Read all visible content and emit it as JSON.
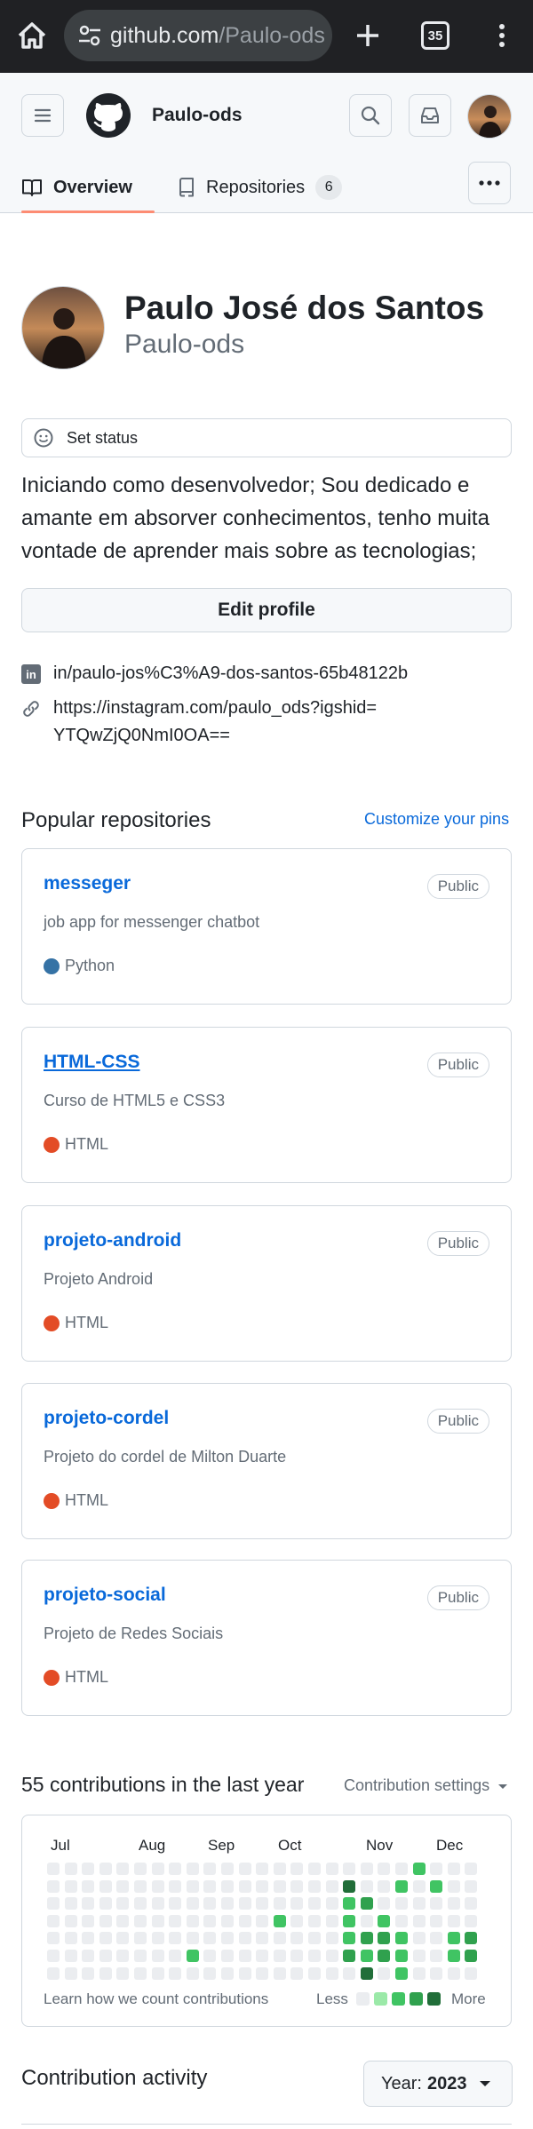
{
  "browser": {
    "url_host": "github.com",
    "url_path": "/Paulo-ods",
    "tab_count": "35"
  },
  "header": {
    "username": "Paulo-ods"
  },
  "tabs": {
    "overview": "Overview",
    "repositories": "Repositories",
    "repositories_count": "6"
  },
  "profile": {
    "full_name": "Paulo José dos Santos",
    "login": "Paulo-ods",
    "status_label": "Set status",
    "bio": "Iniciando como desenvolvedor; Sou dedicado e amante em absorver conhecimentos, tenho muita vontade de aprender mais sobre as tecnologias;",
    "edit_label": "Edit profile",
    "linkedin": "in/paulo-jos%C3%A9-dos-santos-65b48122b",
    "instagram": "https://instagram.com/paulo_ods?igshid=YTQwZjQ0NmI0OA=="
  },
  "popular": {
    "title": "Popular repositories",
    "customize_label": "Customize your pins",
    "repos": [
      {
        "name": "messeger",
        "visibility": "Public",
        "description": "job app for messenger chatbot",
        "language": "Python",
        "language_color": "#3572A5"
      },
      {
        "name": "HTML-CSS",
        "visibility": "Public",
        "description": "Curso de HTML5 e CSS3",
        "language": "HTML",
        "language_color": "#e34c26"
      },
      {
        "name": "projeto-android",
        "visibility": "Public",
        "description": "Projeto Android",
        "language": "HTML",
        "language_color": "#e34c26"
      },
      {
        "name": "projeto-cordel",
        "visibility": "Public",
        "description": "Projeto do cordel de Milton Duarte",
        "language": "HTML",
        "language_color": "#e34c26"
      },
      {
        "name": "projeto-social",
        "visibility": "Public",
        "description": "Projeto de Redes Sociais",
        "language": "HTML",
        "language_color": "#e34c26"
      }
    ]
  },
  "contributions": {
    "title": "55 contributions in the last year",
    "settings_label": "Contribution settings",
    "months": [
      "Jul",
      "Aug",
      "Sep",
      "Oct",
      "Nov",
      "Dec"
    ],
    "learn_label": "Learn how we count contributions",
    "less_label": "Less",
    "more_label": "More",
    "level_colors": [
      "#ebedf0",
      "#9be9a8",
      "#40c463",
      "#30a14e",
      "#216e39"
    ]
  },
  "activity": {
    "title": "Contribution activity",
    "year_prefix": "Year:",
    "year": "2023"
  }
}
